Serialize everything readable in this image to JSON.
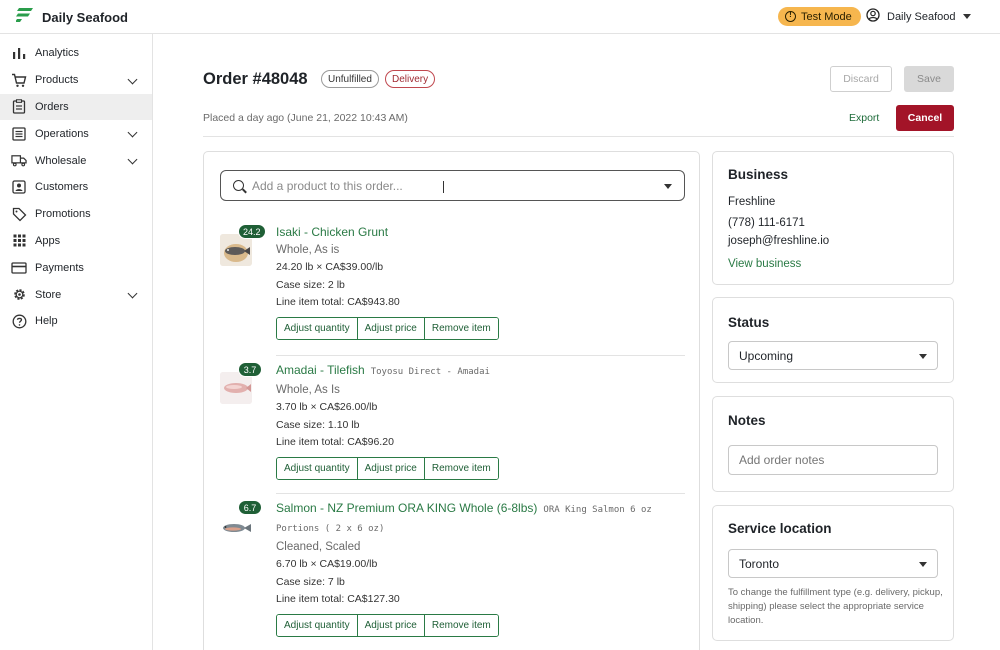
{
  "app": {
    "brand_name": "Daily Seafood",
    "test_mode_label": "Test Mode",
    "account_name": "Daily Seafood",
    "brand_color": "#2a9d4b"
  },
  "sidebar": {
    "items": [
      {
        "label": "Analytics",
        "icon": "bar-chart-icon",
        "expandable": false,
        "active": false
      },
      {
        "label": "Products",
        "icon": "cart-icon",
        "expandable": true,
        "active": false
      },
      {
        "label": "Orders",
        "icon": "clipboard-icon",
        "expandable": false,
        "active": true
      },
      {
        "label": "Operations",
        "icon": "list-icon",
        "expandable": true,
        "active": false
      },
      {
        "label": "Wholesale",
        "icon": "truck-icon",
        "expandable": true,
        "active": false
      },
      {
        "label": "Customers",
        "icon": "person-icon",
        "expandable": false,
        "active": false
      },
      {
        "label": "Promotions",
        "icon": "tag-icon",
        "expandable": false,
        "active": false
      },
      {
        "label": "Apps",
        "icon": "grid-icon",
        "expandable": false,
        "active": false
      },
      {
        "label": "Payments",
        "icon": "card-icon",
        "expandable": false,
        "active": false
      },
      {
        "label": "Store",
        "icon": "gear-icon",
        "expandable": true,
        "active": false
      },
      {
        "label": "Help",
        "icon": "help-icon",
        "expandable": false,
        "active": false
      }
    ]
  },
  "order": {
    "title": "Order #48048",
    "status_badge": "Unfulfilled",
    "type_badge": "Delivery",
    "placed_text": "Placed a day ago (June 21, 2022 10:43 AM)",
    "discard_label": "Discard",
    "save_label": "Save",
    "export_label": "Export",
    "cancel_label": "Cancel"
  },
  "search": {
    "placeholder": "Add a product to this order..."
  },
  "line_items": [
    {
      "qty_badge": "24.2",
      "name": "Isaki - Chicken Grunt",
      "supplier": "",
      "variant": "Whole, As is",
      "price_line": "24.20 lb × CA$39.00/lb",
      "case_size": "Case size: 2 lb",
      "total": "Line item total: CA$943.80",
      "actions": [
        "Adjust quantity",
        "Adjust price",
        "Remove item"
      ]
    },
    {
      "qty_badge": "3.7",
      "name": "Amadai - Tilefish",
      "supplier": "Toyosu Direct - Amadai",
      "variant": "Whole, As Is",
      "price_line": "3.70 lb × CA$26.00/lb",
      "case_size": "Case size: 1.10 lb",
      "total": "Line item total: CA$96.20",
      "actions": [
        "Adjust quantity",
        "Adjust price",
        "Remove item"
      ]
    },
    {
      "qty_badge": "6.7",
      "name": "Salmon - NZ Premium ORA KING Whole (6-8lbs)",
      "supplier": "ORA King Salmon 6 oz Portions ( 2 x 6 oz)",
      "variant": "Cleaned, Scaled",
      "price_line": "6.70 lb × CA$19.00/lb",
      "case_size": "Case size: 7 lb",
      "total": "Line item total: CA$127.30",
      "actions": [
        "Adjust quantity",
        "Adjust price",
        "Remove item"
      ]
    }
  ],
  "business": {
    "heading": "Business",
    "name": "Freshline",
    "phone": "(778) 111-6171",
    "email": "joseph@freshline.io",
    "link_label": "View business"
  },
  "status": {
    "heading": "Status",
    "value": "Upcoming"
  },
  "notes": {
    "heading": "Notes",
    "placeholder": "Add order notes"
  },
  "service_location": {
    "heading": "Service location",
    "value": "Toronto",
    "help_text": "To change the fulfillment type (e.g. delivery, pickup, shipping) please select the appropriate service location."
  }
}
